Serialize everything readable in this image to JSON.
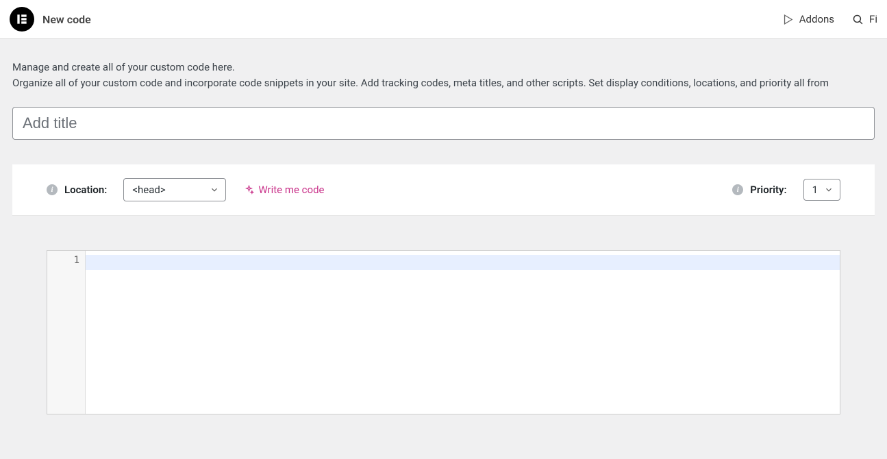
{
  "topbar": {
    "title": "New code",
    "addons": "Addons",
    "search_text": "Fi"
  },
  "description": {
    "line1": "Manage and create all of your custom code here.",
    "line2": "Organize all of your custom code and incorporate code snippets in your site. Add tracking codes, meta titles, and other scripts. Set display conditions, locations, and priority all from"
  },
  "title_input": {
    "placeholder": "Add title",
    "value": ""
  },
  "controls": {
    "location_label": "Location:",
    "location_value": "<head>",
    "write_code": "Write me code",
    "priority_label": "Priority:",
    "priority_value": "1"
  },
  "editor": {
    "first_line_number": "1"
  }
}
